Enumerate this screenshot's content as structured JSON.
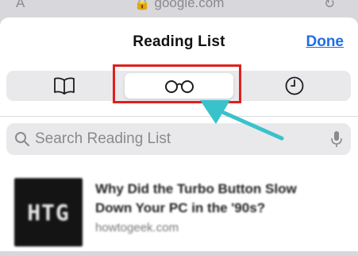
{
  "address_bar": {
    "text_size_label": "A",
    "domain": "google.com",
    "reload_glyph": "↻"
  },
  "header": {
    "title": "Reading List",
    "done_label": "Done"
  },
  "tabs": [
    {
      "icon": "book-icon",
      "selected": false
    },
    {
      "icon": "glasses-icon",
      "selected": true
    },
    {
      "icon": "clock-icon",
      "selected": false
    }
  ],
  "search": {
    "placeholder": "Search Reading List",
    "value": ""
  },
  "items": [
    {
      "thumbnail_text": "HTG",
      "title": "Why Did the Turbo Button Slow Down Your PC in the '90s?",
      "domain": "howtogeek.com"
    }
  ],
  "colors": {
    "accent": "#1e6fe6",
    "highlight": "#e0201e",
    "arrow": "#39c2cc"
  }
}
